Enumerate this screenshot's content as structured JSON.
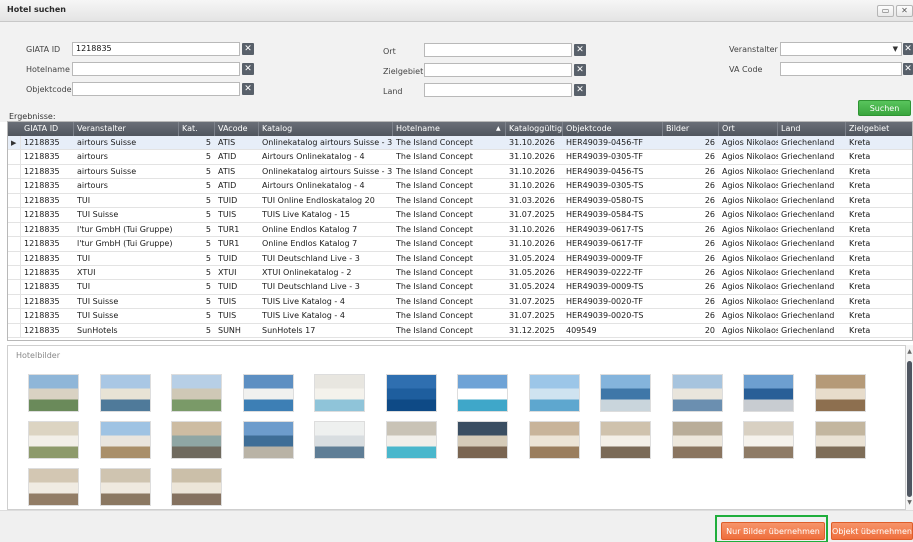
{
  "window": {
    "title": "Hotel suchen",
    "restore_glyph": "▭",
    "close_glyph": "✕"
  },
  "search": {
    "giata_label": "GIATA ID",
    "giata_value": "1218835",
    "hotelname_label": "Hotelname",
    "hotelname_value": "",
    "objektcode_label": "Objektcode",
    "objektcode_value": "",
    "ort_label": "Ort",
    "ort_value": "",
    "zielgebiet_label": "Zielgebiet",
    "zielgebiet_value": "",
    "land_label": "Land",
    "land_value": "",
    "veranstalter_label": "Veranstalter",
    "veranstalter_value": "",
    "vacode_label": "VA Code",
    "vacode_value": "",
    "clear_glyph": "✕",
    "search_button": "Suchen"
  },
  "results": {
    "label": "Ergebnisse:",
    "columns": [
      "GIATA ID",
      "Veranstalter",
      "Kat.",
      "VAcode",
      "Katalog",
      "Hotelname",
      "Kataloggültigkeit",
      "Objektcode",
      "Bilder",
      "Ort",
      "Land",
      "Zielgebiet"
    ],
    "sort_glyph": "▲",
    "row_marker": "▶",
    "rows": [
      [
        "1218835",
        "airtours Suisse",
        "5",
        "ATIS",
        "Onlinekatalog airtours Suisse - 3",
        "The Island Concept",
        "31.10.2026",
        "HER49039-0456-TF",
        "26",
        "Agios Nikolaos",
        "Griechenland",
        "Kreta"
      ],
      [
        "1218835",
        "airtours",
        "5",
        "ATID",
        "Airtours Onlinekatalog - 4",
        "The Island Concept",
        "31.10.2026",
        "HER49039-0305-TF",
        "26",
        "Agios Nikolaos",
        "Griechenland",
        "Kreta"
      ],
      [
        "1218835",
        "airtours Suisse",
        "5",
        "ATIS",
        "Onlinekatalog airtours Suisse - 3",
        "The Island Concept",
        "31.10.2026",
        "HER49039-0456-TS",
        "26",
        "Agios Nikolaos",
        "Griechenland",
        "Kreta"
      ],
      [
        "1218835",
        "airtours",
        "5",
        "ATID",
        "Airtours Onlinekatalog - 4",
        "The Island Concept",
        "31.10.2026",
        "HER49039-0305-TS",
        "26",
        "Agios Nikolaos",
        "Griechenland",
        "Kreta"
      ],
      [
        "1218835",
        "TUI",
        "5",
        "TUID",
        "TUI Online Endloskatalog 20",
        "The Island Concept",
        "31.03.2026",
        "HER49039-0580-TS",
        "26",
        "Agios Nikolaos",
        "Griechenland",
        "Kreta"
      ],
      [
        "1218835",
        "TUI Suisse",
        "5",
        "TUIS",
        "TUIS Live Katalog - 15",
        "The Island Concept",
        "31.07.2025",
        "HER49039-0584-TS",
        "26",
        "Agios Nikolaos",
        "Griechenland",
        "Kreta"
      ],
      [
        "1218835",
        "l'tur GmbH (Tui Gruppe)",
        "5",
        "TUR1",
        "Online Endlos Katalog 7",
        "The Island Concept",
        "31.10.2026",
        "HER49039-0617-TS",
        "26",
        "Agios Nikolaos",
        "Griechenland",
        "Kreta"
      ],
      [
        "1218835",
        "l'tur GmbH (Tui Gruppe)",
        "5",
        "TUR1",
        "Online Endlos Katalog 7",
        "The Island Concept",
        "31.10.2026",
        "HER49039-0617-TF",
        "26",
        "Agios Nikolaos",
        "Griechenland",
        "Kreta"
      ],
      [
        "1218835",
        "TUI",
        "5",
        "TUID",
        "TUI Deutschland Live - 3",
        "The Island Concept",
        "31.05.2024",
        "HER49039-0009-TF",
        "26",
        "Agios Nikolaos",
        "Griechenland",
        "Kreta"
      ],
      [
        "1218835",
        "XTUI",
        "5",
        "XTUI",
        "XTUI Onlinekatalog - 2",
        "The Island Concept",
        "31.05.2026",
        "HER49039-0222-TF",
        "26",
        "Agios Nikolaos",
        "Griechenland",
        "Kreta"
      ],
      [
        "1218835",
        "TUI",
        "5",
        "TUID",
        "TUI Deutschland Live - 3",
        "The Island Concept",
        "31.05.2024",
        "HER49039-0009-TS",
        "26",
        "Agios Nikolaos",
        "Griechenland",
        "Kreta"
      ],
      [
        "1218835",
        "TUI Suisse",
        "5",
        "TUIS",
        "TUIS Live Katalog - 4",
        "The Island Concept",
        "31.07.2025",
        "HER49039-0020-TF",
        "26",
        "Agios Nikolaos",
        "Griechenland",
        "Kreta"
      ],
      [
        "1218835",
        "TUI Suisse",
        "5",
        "TUIS",
        "TUIS Live Katalog - 4",
        "The Island Concept",
        "31.07.2025",
        "HER49039-0020-TS",
        "26",
        "Agios Nikolaos",
        "Griechenland",
        "Kreta"
      ],
      [
        "1218835",
        "SunHotels",
        "5",
        "SUNH",
        "SunHotels 17",
        "The Island Concept",
        "31.12.2025",
        "409549",
        "20",
        "Agios Nikolaos",
        "Griechenland",
        "Kreta"
      ]
    ]
  },
  "images": {
    "legend": "Hotelbilder",
    "scroll_up": "▲",
    "scroll_down": "▼",
    "thumbnails": [
      {
        "sky": "#8fb6d8",
        "mid": "#d9d2c3",
        "ground": "#6a8a5a"
      },
      {
        "sky": "#a9c7e4",
        "mid": "#e8e3d5",
        "ground": "#4f7a9a"
      },
      {
        "sky": "#b7cfe6",
        "mid": "#cfc8b6",
        "ground": "#7a9a68"
      },
      {
        "sky": "#5d8fc2",
        "mid": "#f1f1ef",
        "ground": "#3d7fb5"
      },
      {
        "sky": "#e8e6e0",
        "mid": "#f4f2ec",
        "ground": "#8fc4d9"
      },
      {
        "sky": "#2f6fb0",
        "mid": "#1e5e9e",
        "ground": "#0e4a86"
      },
      {
        "sky": "#6fa3d6",
        "mid": "#ffffff",
        "ground": "#3fa7c9"
      },
      {
        "sky": "#9cc6e8",
        "mid": "#cfe3f0",
        "ground": "#5ea7cf"
      },
      {
        "sky": "#84b4dc",
        "mid": "#3f77a8",
        "ground": "#c9d5dc"
      },
      {
        "sky": "#a7c4de",
        "mid": "#e9e5dc",
        "ground": "#6b8fb0"
      },
      {
        "sky": "#6d9fd0",
        "mid": "#295f97",
        "ground": "#c8ccd1"
      },
      {
        "sky": "#b59a78",
        "mid": "#e7dccb",
        "ground": "#8d6f4f"
      },
      {
        "sky": "#dcd4c2",
        "mid": "#f2efe8",
        "ground": "#8d9a6b"
      },
      {
        "sky": "#9fc3e3",
        "mid": "#e9e5de",
        "ground": "#a98f6a"
      },
      {
        "sky": "#cdbca2",
        "mid": "#8fa6a4",
        "ground": "#6f6a5e"
      },
      {
        "sky": "#6d9ccc",
        "mid": "#3f6e97",
        "ground": "#b9b3a6"
      },
      {
        "sky": "#eef0ef",
        "mid": "#d8dde0",
        "ground": "#5f7e96"
      },
      {
        "sky": "#c9c3b6",
        "mid": "#f1efea",
        "ground": "#4ab7cc"
      },
      {
        "sky": "#3a4e62",
        "mid": "#d5cbb8",
        "ground": "#7a6551"
      },
      {
        "sky": "#c8b49a",
        "mid": "#ece4d6",
        "ground": "#9a7e5e"
      },
      {
        "sky": "#cfc2ad",
        "mid": "#f3efe7",
        "ground": "#7a6a57"
      },
      {
        "sky": "#b9ad99",
        "mid": "#ede7dc",
        "ground": "#8a7560"
      },
      {
        "sky": "#d8d0c2",
        "mid": "#f5f2ec",
        "ground": "#8e7b66"
      },
      {
        "sky": "#c3b69f",
        "mid": "#eae2d4",
        "ground": "#7e6d58"
      },
      {
        "sky": "#d3c7b3",
        "mid": "#f0ebe2",
        "ground": "#927d66"
      },
      {
        "sky": "#cfc4b0",
        "mid": "#efe9df",
        "ground": "#8b7862"
      },
      {
        "sky": "#cbbfa9",
        "mid": "#ece5d8",
        "ground": "#857260"
      }
    ]
  },
  "footer": {
    "nur_bilder_button": "Nur Bilder übernehmen",
    "objekt_button": "Objekt übernehmen"
  }
}
